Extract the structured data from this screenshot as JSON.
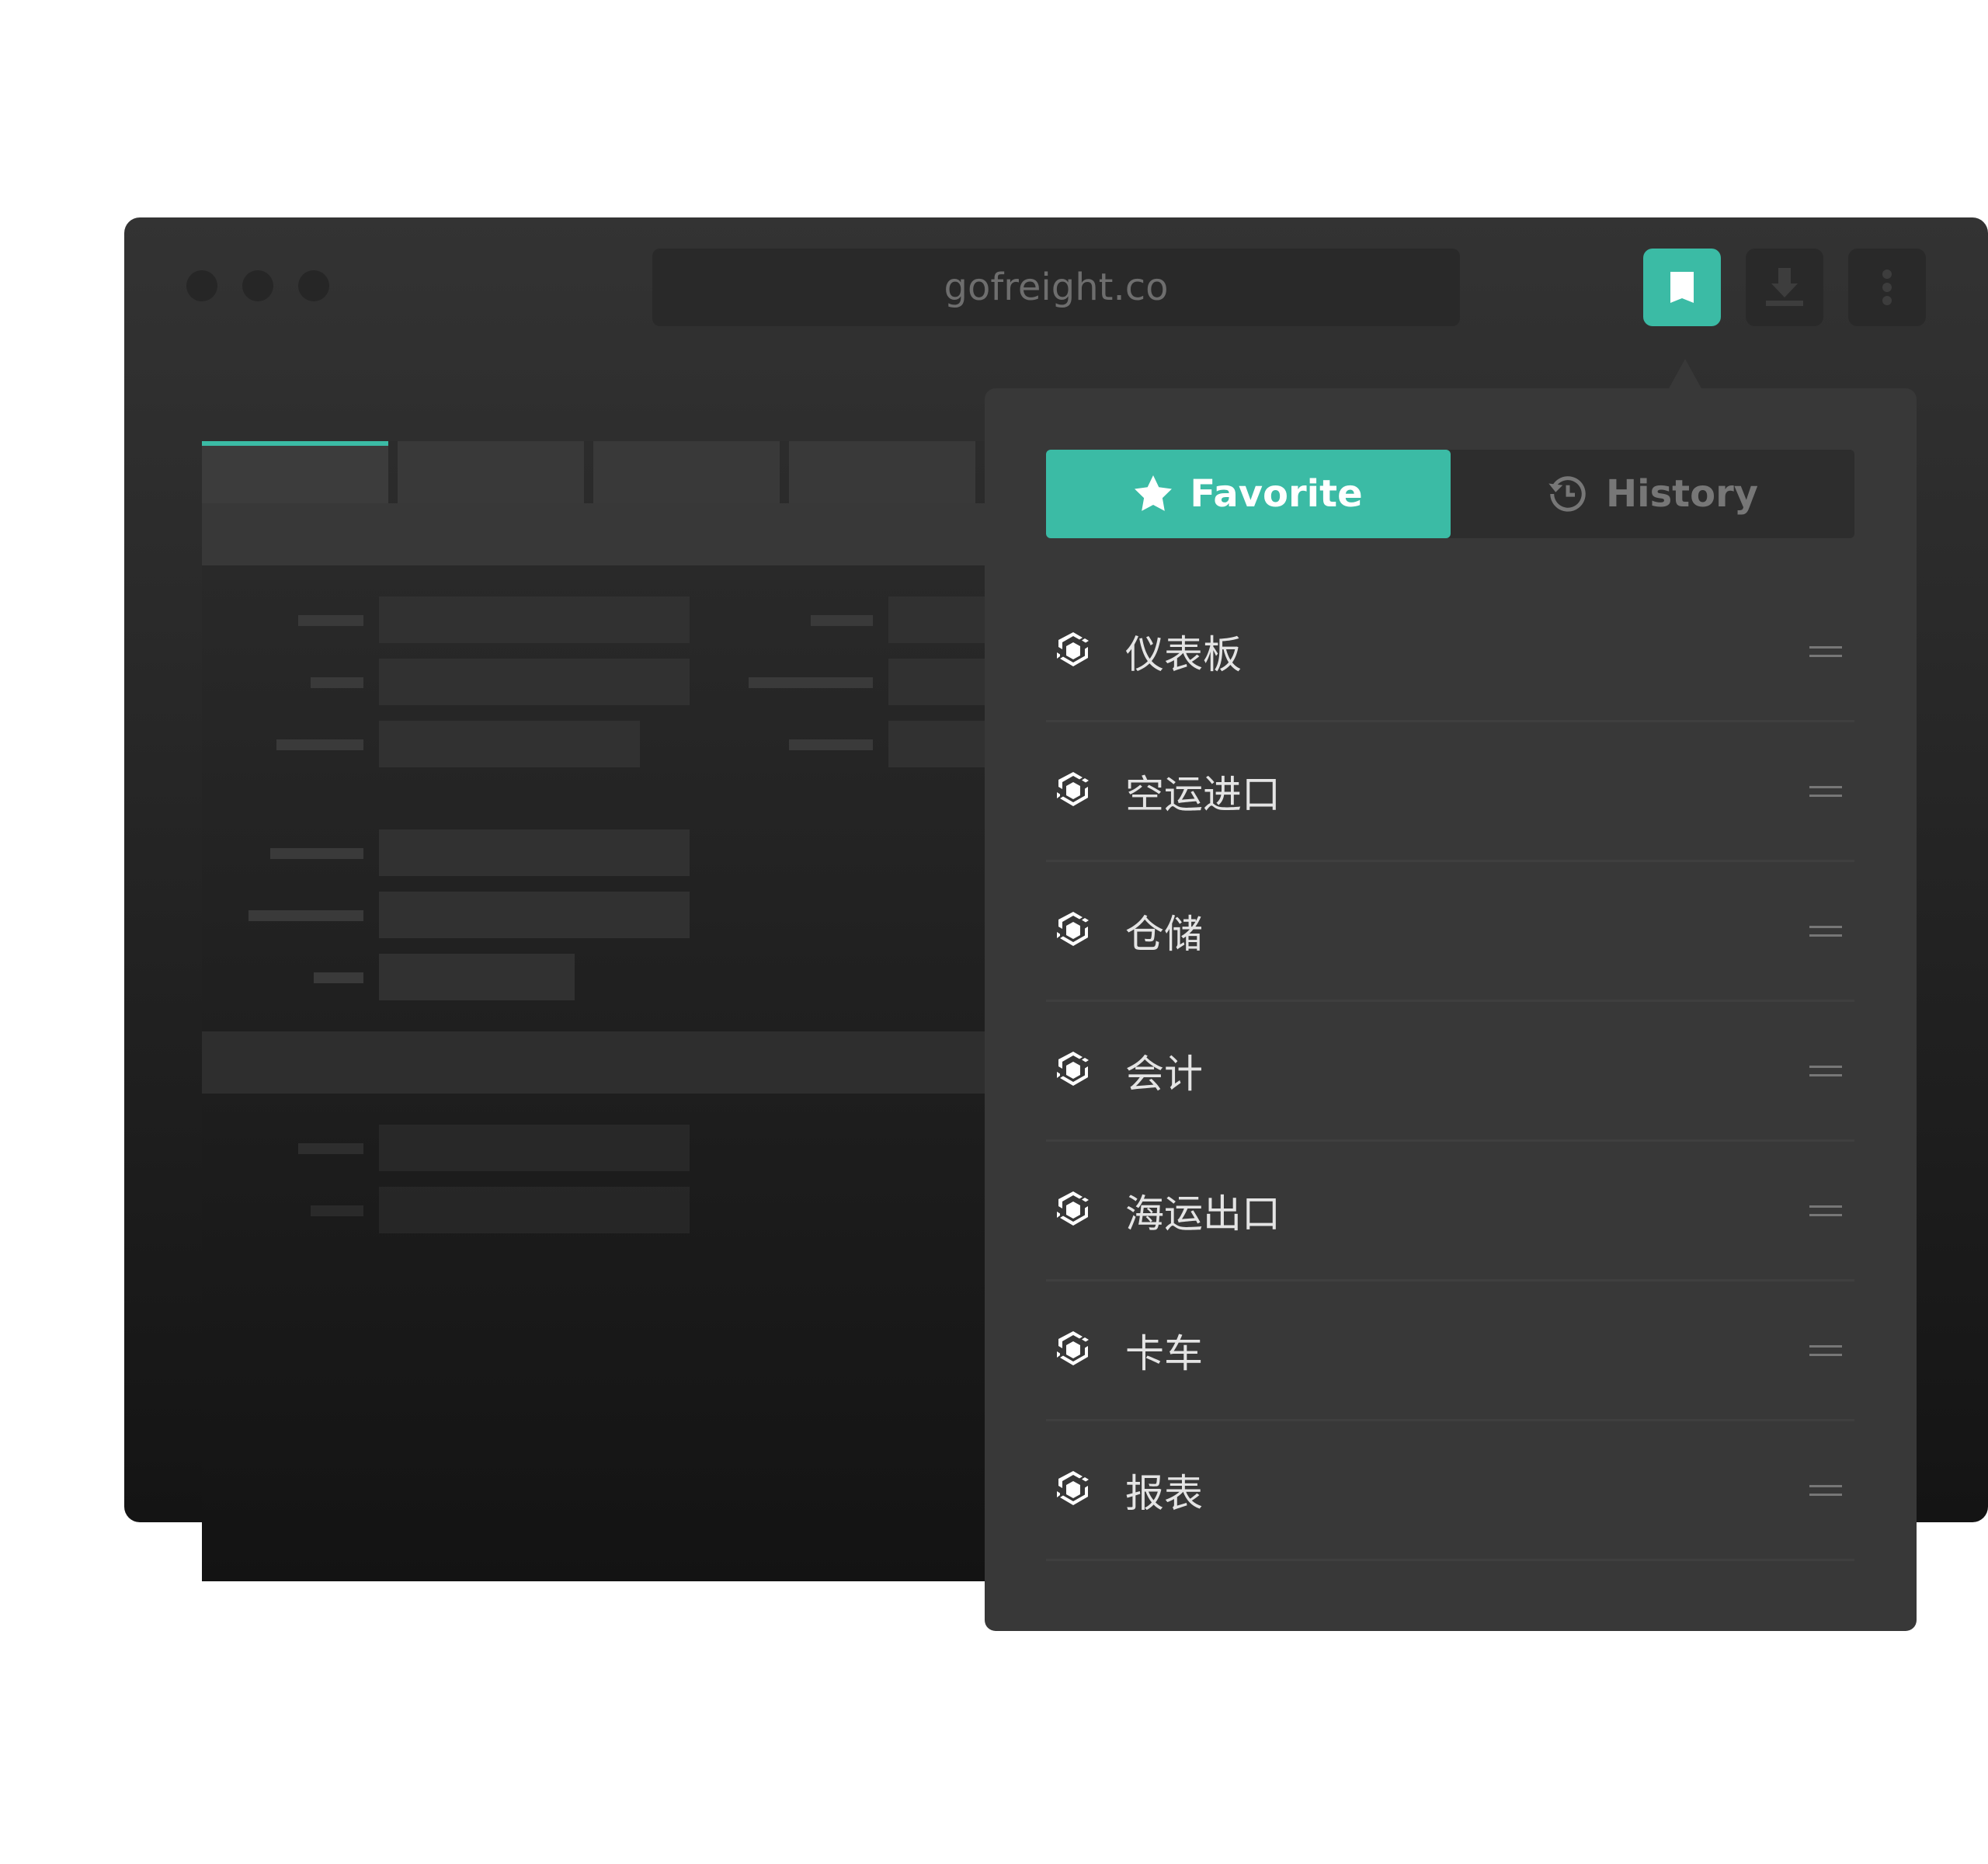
{
  "browser": {
    "url": "gofreight.co",
    "toolbar": [
      {
        "icon": "bookmark-icon",
        "active": true
      },
      {
        "icon": "download-icon"
      },
      {
        "icon": "more-vertical-icon"
      }
    ]
  },
  "colors": {
    "accent": "#3bbba5"
  },
  "panel": {
    "tabs": [
      {
        "label": "Favorite",
        "icon": "star-icon",
        "active": true
      },
      {
        "label": "History",
        "icon": "history-icon"
      }
    ],
    "items": [
      {
        "label": "仪表板"
      },
      {
        "label": "空运进口"
      },
      {
        "label": "仓储"
      },
      {
        "label": "会计"
      },
      {
        "label": "海运出口"
      },
      {
        "label": "卡车"
      },
      {
        "label": "报表"
      }
    ]
  }
}
